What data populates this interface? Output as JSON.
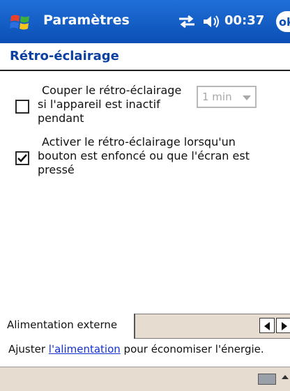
{
  "titlebar": {
    "app_title": "Paramètres",
    "clock": "00:37",
    "ok_label": "ok"
  },
  "page": {
    "title": "Rétro-éclairage"
  },
  "options": [
    {
      "checked": false,
      "lines": [
        "Couper le rétro-éclairage",
        "si l'appareil est inactif",
        "pendant"
      ],
      "dropdown_value": "1 min"
    },
    {
      "checked": true,
      "lines": [
        "Activer le rétro-éclairage lorsqu'un",
        "bouton est enfoncé ou que l'écran est",
        "pressé"
      ]
    }
  ],
  "tabs": {
    "active_label": "Alimentation externe"
  },
  "info": {
    "prefix": "Ajuster ",
    "link": "l'alimentation",
    "suffix": " pour économiser l'énergie."
  },
  "colors": {
    "titlebar": "#0b4fb4",
    "heading": "#0b3fa0",
    "link": "#1230d0",
    "menubar": "#e6dcd0"
  },
  "icons": [
    "windows-start-icon",
    "connectivity-icon",
    "volume-icon",
    "keyboard-icon"
  ]
}
